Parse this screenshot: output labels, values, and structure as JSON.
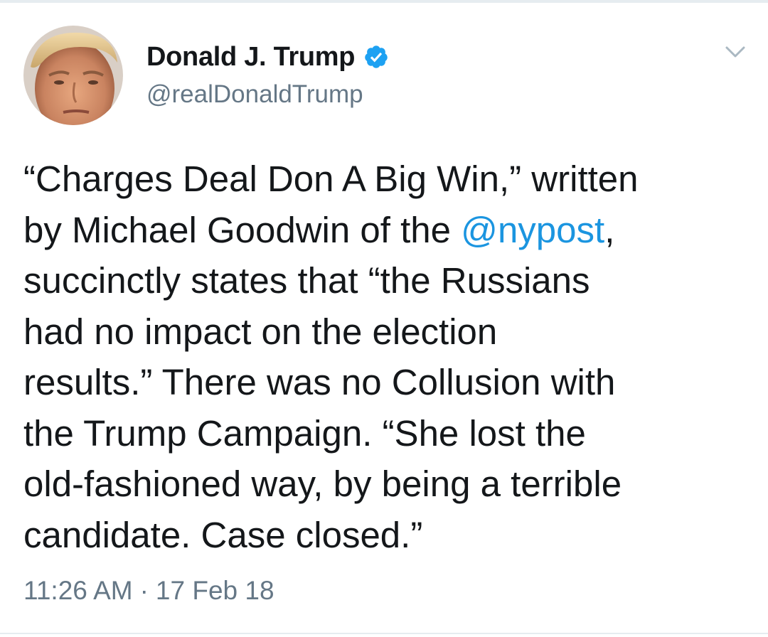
{
  "tweet": {
    "author": {
      "display_name": "Donald J. Trump",
      "handle": "@realDonaldTrump",
      "verified_icon": "verified-badge-icon",
      "avatar_icon": "profile-photo"
    },
    "menu_icon": "chevron-down-icon",
    "text_lines": [
      "“Charges Deal Don A Big Win,” written",
      "by Michael Goodwin of the ",
      "succinctly states that “the Russians",
      "had no impact on the election",
      "results.” There was no Collusion with",
      "the Trump Campaign. “She lost the",
      "old-fashioned way, by being a terrible",
      "candidate. Case closed.”"
    ],
    "mention": "@nypost",
    "mention_suffix": ",",
    "time": "11:26 AM",
    "separator": "·",
    "date": "17 Feb 18"
  },
  "colors": {
    "text": "#14171a",
    "secondary": "#657786",
    "link": "#1b95e0",
    "verified": "#1da1f2",
    "divider": "#e6ecf0"
  }
}
